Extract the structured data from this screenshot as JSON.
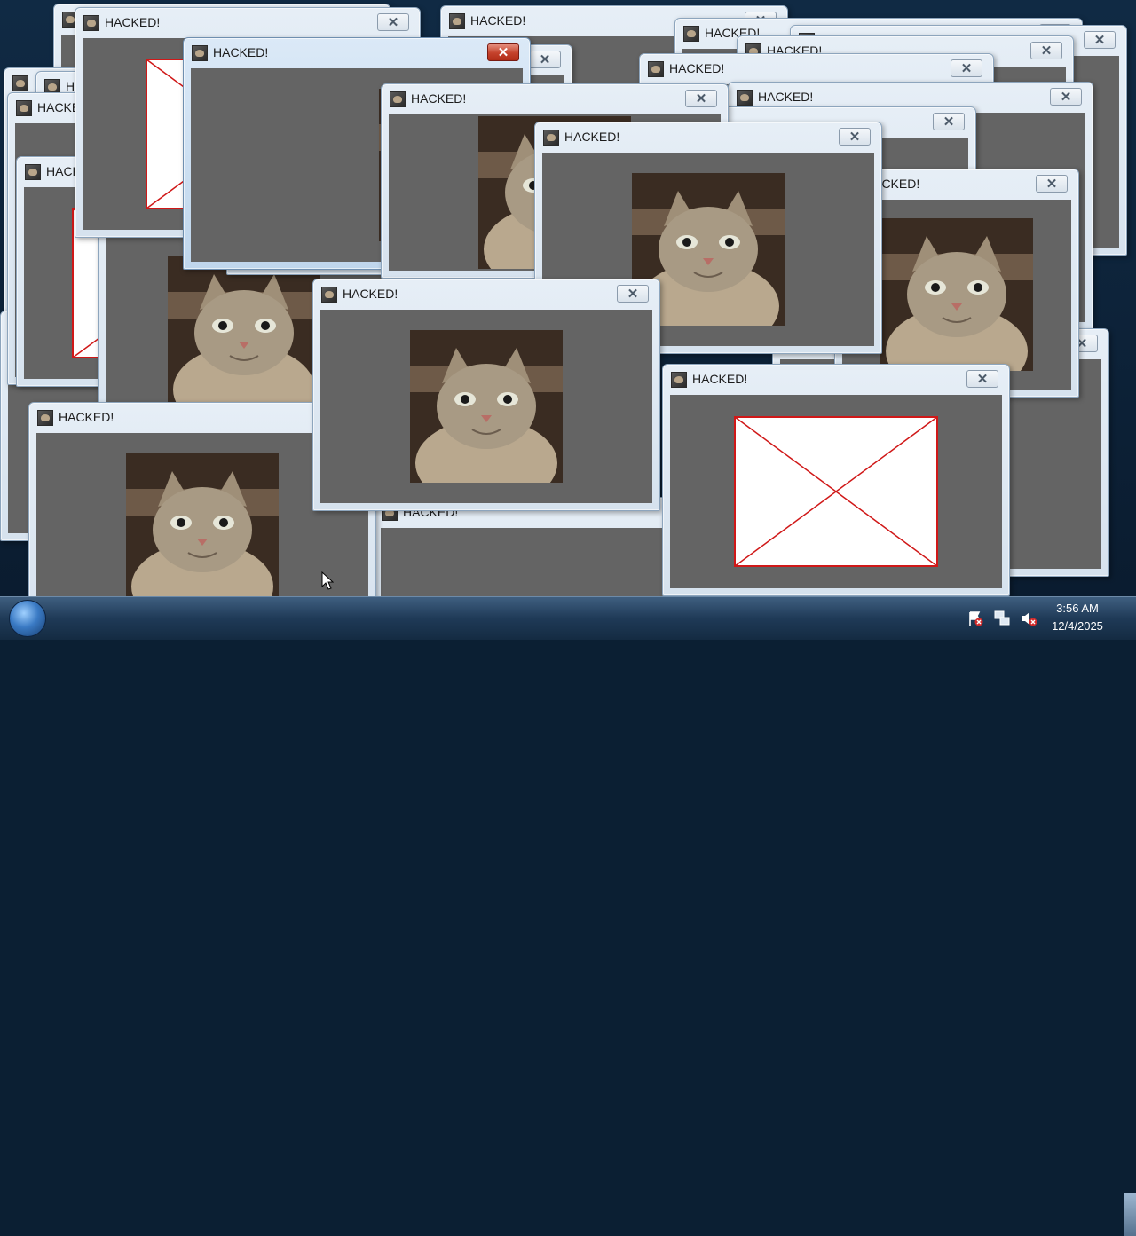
{
  "popup": {
    "title": "HACKED!",
    "close_glyph": "✕",
    "app_icon": "cat-icon",
    "image_kind": [
      "cat-photo",
      "broken-image"
    ]
  },
  "windows": [
    {
      "id": "bg-1",
      "image": "none"
    },
    {
      "id": "bg-2",
      "image": "none"
    },
    {
      "id": "bg-3",
      "image": "none"
    },
    {
      "id": "bg-4",
      "image": "none"
    },
    {
      "id": "bg-5",
      "image": "none"
    },
    {
      "id": "bg-6",
      "image": "none"
    },
    {
      "id": "bg-7",
      "image": "none"
    },
    {
      "id": "bg-8",
      "image": "none"
    },
    {
      "id": "bg-9",
      "image": "none"
    },
    {
      "id": "bg-10",
      "image": "none"
    },
    {
      "id": "bg-11",
      "image": "none"
    },
    {
      "id": "bg-12",
      "image": "none"
    },
    {
      "id": "left-1",
      "image": "none"
    },
    {
      "id": "left-2",
      "image": "none"
    },
    {
      "id": "left-3",
      "image": "broken"
    },
    {
      "id": "left-4",
      "image": "cat"
    },
    {
      "id": "top-broken",
      "image": "broken"
    },
    {
      "id": "mid-cat-partial",
      "image": "cat"
    },
    {
      "id": "active-window",
      "image": "cat"
    },
    {
      "id": "center-cat",
      "image": "cat"
    },
    {
      "id": "right-cat",
      "image": "cat"
    },
    {
      "id": "front-center",
      "image": "cat"
    },
    {
      "id": "front-left",
      "image": "cat"
    },
    {
      "id": "front-right",
      "image": "broken"
    }
  ],
  "taskbar": {
    "clock_time": "3:56 AM",
    "clock_date": "12/4/2025",
    "tray_icons": [
      "action-center-flag-icon",
      "network-icon",
      "speaker-muted-icon"
    ]
  },
  "colors": {
    "window_client": "#646464",
    "title_text": "#1b1b1b",
    "close_active": "#c4412b",
    "broken_image_border": "#d01818"
  }
}
